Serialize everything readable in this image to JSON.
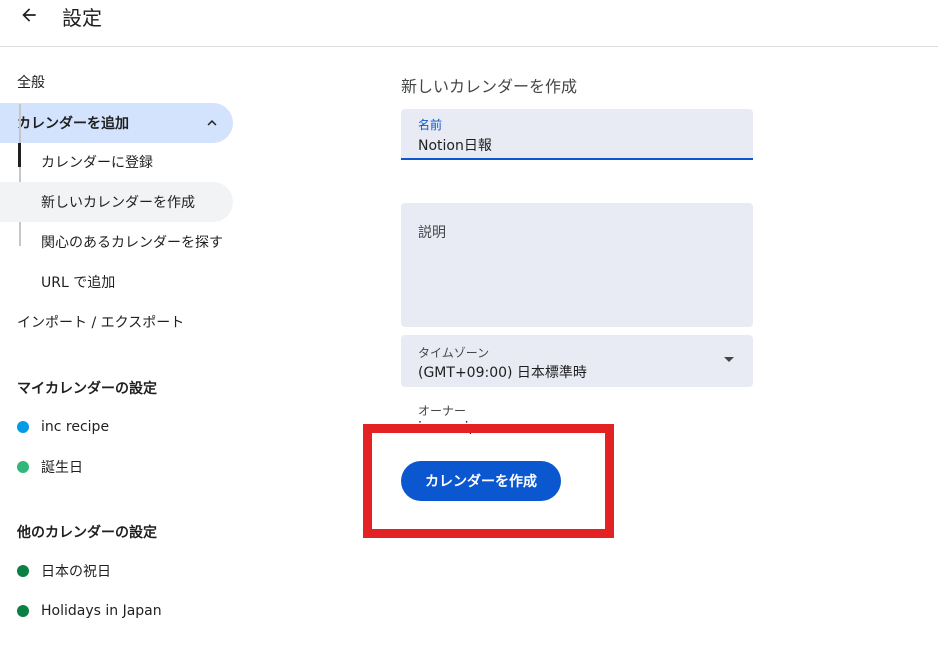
{
  "header": {
    "title": "設定",
    "back_icon": "arrow-back-icon"
  },
  "sidebar": {
    "general": "全般",
    "add_calendar": {
      "label": "カレンダーを追加",
      "icon": "chevron-up-icon",
      "items": [
        {
          "label": "カレンダーに登録"
        },
        {
          "label": "新しいカレンダーを作成",
          "selected": true
        },
        {
          "label": "関心のあるカレンダーを探す"
        },
        {
          "label": "URL で追加"
        }
      ]
    },
    "import_export": "インポート / エクスポート",
    "my_calendars": {
      "heading": "マイカレンダーの設定",
      "items": [
        {
          "label": "inc recipe",
          "color": "#039be5"
        },
        {
          "label": "誕生日",
          "color": "#33b679"
        }
      ]
    },
    "other_calendars": {
      "heading": "他のカレンダーの設定",
      "items": [
        {
          "label": "日本の祝日",
          "color": "#0b8043"
        },
        {
          "label": "Holidays in Japan",
          "color": "#0b8043"
        }
      ]
    }
  },
  "form": {
    "title": "新しいカレンダーを作成",
    "name": {
      "label": "名前",
      "value": "Notion日報"
    },
    "description": {
      "label": "説明",
      "value": ""
    },
    "timezone": {
      "label": "タイムゾーン",
      "value": "(GMT+09:00) 日本標準時",
      "icon": "dropdown-caret-icon"
    },
    "owner": {
      "label": "オーナー",
      "value": "inc recipe"
    },
    "create_button": "カレンダーを作成"
  },
  "annotation": {
    "highlight_color": "#e32323"
  }
}
